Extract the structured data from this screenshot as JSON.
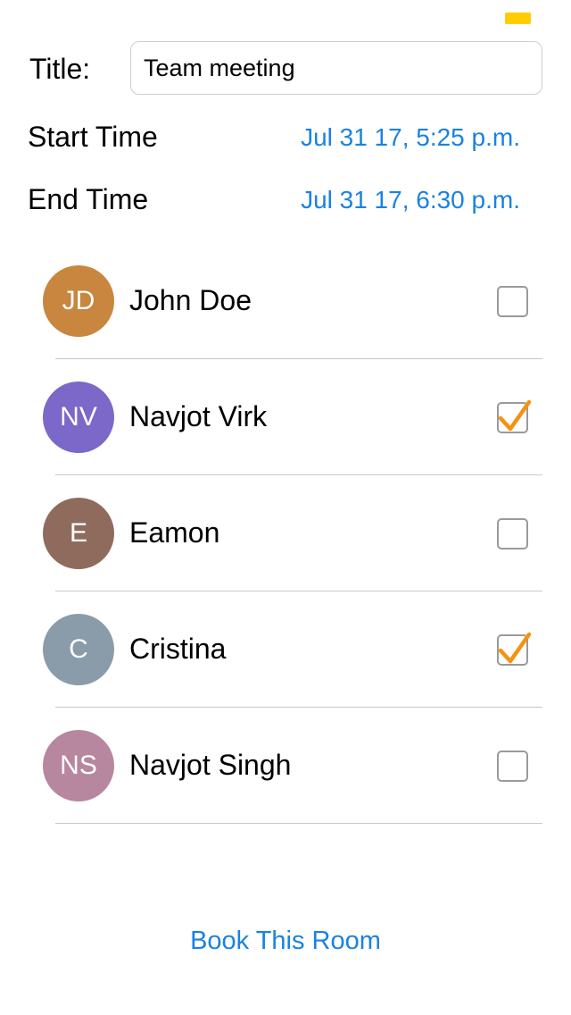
{
  "colors": {
    "accent": "#1a82e2",
    "check": "#f5920f",
    "battery": "#ffcc00"
  },
  "form": {
    "title_label": "Title:",
    "title_value": "Team meeting",
    "start_label": "Start Time",
    "start_value": "Jul 31 17, 5:25 p.m.",
    "end_label": "End Time",
    "end_value": "Jul 31 17, 6:30 p.m."
  },
  "attendees": [
    {
      "initials": "JD",
      "name": "John Doe",
      "color": "#c8863e",
      "checked": false
    },
    {
      "initials": "NV",
      "name": "Navjot Virk",
      "color": "#7b68c8",
      "checked": true
    },
    {
      "initials": "E",
      "name": "Eamon",
      "color": "#8f6b5d",
      "checked": false
    },
    {
      "initials": "C",
      "name": "Cristina",
      "color": "#8a9ba9",
      "checked": true
    },
    {
      "initials": "NS",
      "name": "Navjot Singh",
      "color": "#b7869f",
      "checked": false
    }
  ],
  "book_button_label": "Book This Room"
}
